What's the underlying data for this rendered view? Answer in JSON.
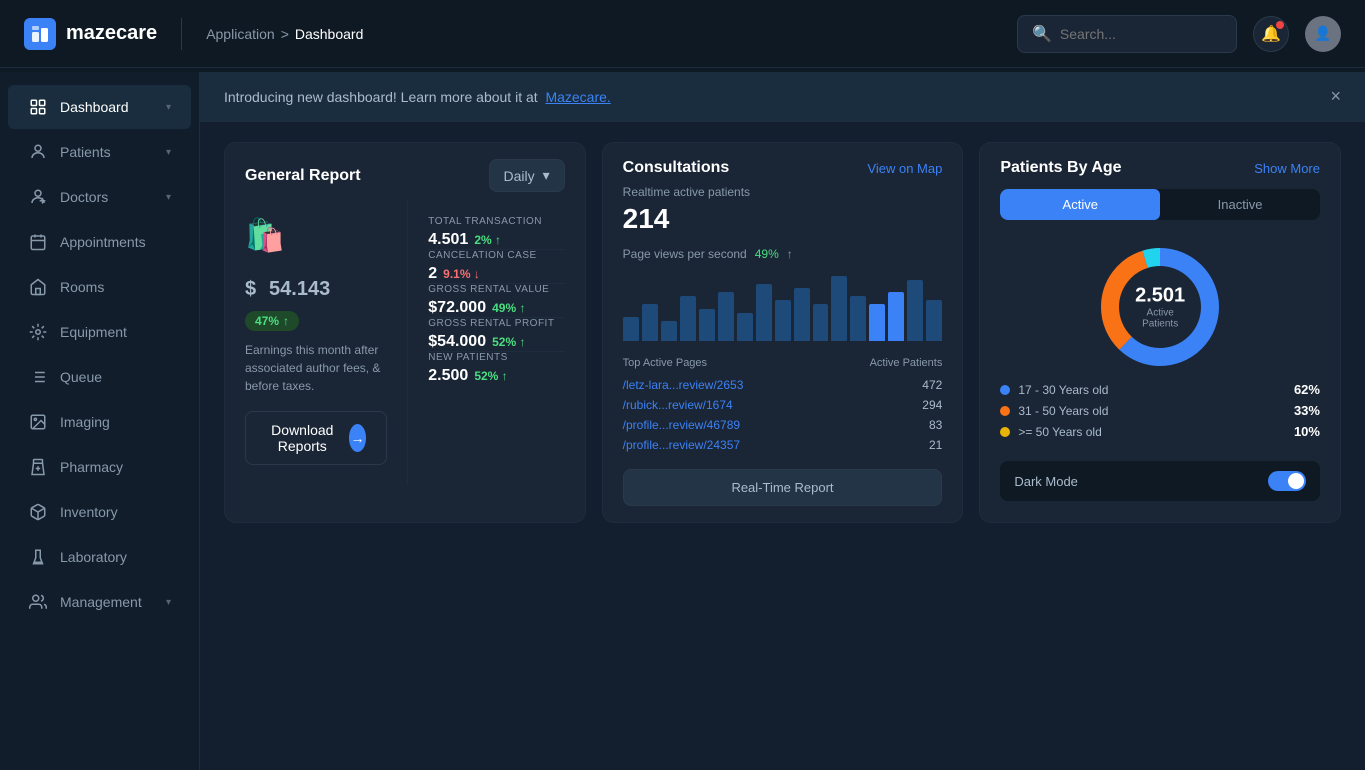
{
  "app": {
    "logo_text": "mazecare",
    "breadcrumb_app": "Application",
    "breadcrumb_sep": ">",
    "breadcrumb_current": "Dashboard"
  },
  "navbar": {
    "search_placeholder": "Search...",
    "avatar_initials": ""
  },
  "banner": {
    "text": "Introducing new dashboard! Learn more about it at",
    "link_text": "Mazecare.",
    "close_label": "×"
  },
  "sidebar": {
    "items": [
      {
        "id": "dashboard",
        "label": "Dashboard",
        "icon": "🏠",
        "active": true,
        "has_chevron": true
      },
      {
        "id": "patients",
        "label": "Patients",
        "icon": "👤",
        "active": false,
        "has_chevron": true
      },
      {
        "id": "doctors",
        "label": "Doctors",
        "icon": "👨‍⚕️",
        "active": false,
        "has_chevron": true
      },
      {
        "id": "appointments",
        "label": "Appointments",
        "icon": "📅",
        "active": false,
        "has_chevron": false
      },
      {
        "id": "rooms",
        "label": "Rooms",
        "icon": "🏠",
        "active": false,
        "has_chevron": false
      },
      {
        "id": "equipment",
        "label": "Equipment",
        "icon": "🔧",
        "active": false,
        "has_chevron": false
      },
      {
        "id": "queue",
        "label": "Queue",
        "icon": "📋",
        "active": false,
        "has_chevron": false
      },
      {
        "id": "imaging",
        "label": "Imaging",
        "icon": "🖼️",
        "active": false,
        "has_chevron": false
      },
      {
        "id": "pharmacy",
        "label": "Pharmacy",
        "icon": "💊",
        "active": false,
        "has_chevron": false
      },
      {
        "id": "inventory",
        "label": "Inventory",
        "icon": "📦",
        "active": false,
        "has_chevron": false
      },
      {
        "id": "laboratory",
        "label": "Laboratory",
        "icon": "🔬",
        "active": false,
        "has_chevron": false
      },
      {
        "id": "management",
        "label": "Management",
        "icon": "📊",
        "active": false,
        "has_chevron": true
      }
    ]
  },
  "general_report": {
    "title": "General Report",
    "period_label": "Daily",
    "icon": "🛍️",
    "amount": "54.143",
    "currency": "$",
    "badge_pct": "47%",
    "badge_arrow": "↑",
    "description": "Earnings this month after associated author fees, & before taxes.",
    "download_btn_label": "Download Reports",
    "stats": [
      {
        "label": "TOTAL TRANSACTION",
        "value": "4.501",
        "pct": "2%",
        "trend": "up"
      },
      {
        "label": "CANCELATION CASE",
        "value": "2",
        "pct": "9.1%",
        "trend": "down"
      },
      {
        "label": "GROSS RENTAL VALUE",
        "value": "$72.000",
        "pct": "49%",
        "trend": "up"
      },
      {
        "label": "GROSS RENTAL PROFIT",
        "value": "$54.000",
        "pct": "52%",
        "trend": "up"
      },
      {
        "label": "NEW PATIENTS",
        "value": "2.500",
        "pct": "52%",
        "trend": "up"
      }
    ]
  },
  "consultations": {
    "title": "Consultations",
    "map_link": "View on Map",
    "realtime_label": "Realtime active patients",
    "realtime_num": "214",
    "views_label": "Page views per second",
    "views_pct": "49%",
    "bars": [
      30,
      45,
      25,
      55,
      40,
      60,
      35,
      70,
      50,
      65,
      45,
      80,
      55,
      45,
      60,
      75,
      50
    ],
    "table_headers": [
      "Top Active Pages",
      "Active Patients"
    ],
    "table_rows": [
      {
        "path": "/letz-lara...review/2653",
        "count": "472"
      },
      {
        "path": "/rubick...review/1674",
        "count": "294"
      },
      {
        "path": "/profile...review/46789",
        "count": "83"
      },
      {
        "path": "/profile...review/24357",
        "count": "21"
      }
    ],
    "realtime_btn": "Real-Time Report"
  },
  "patients_by_age": {
    "title": "Patients By Age",
    "show_more": "Show More",
    "tabs": [
      "Active",
      "Inactive"
    ],
    "active_tab": "Active",
    "donut_center_num": "2.501",
    "donut_center_label": "Active Patients",
    "legend": [
      {
        "label": "17 - 30 Years old",
        "pct": "62%",
        "color": "#3b82f6"
      },
      {
        "label": "31 - 50 Years old",
        "pct": "33%",
        "color": "#f97316"
      },
      {
        "label": ">= 50 Years old",
        "pct": "10%",
        "color": "#eab308"
      }
    ],
    "dark_mode_label": "Dark Mode"
  },
  "colors": {
    "primary": "#3b82f6",
    "success": "#4ade80",
    "danger": "#f87171",
    "orange": "#f97316",
    "yellow": "#eab308",
    "cyan": "#22d3ee"
  }
}
